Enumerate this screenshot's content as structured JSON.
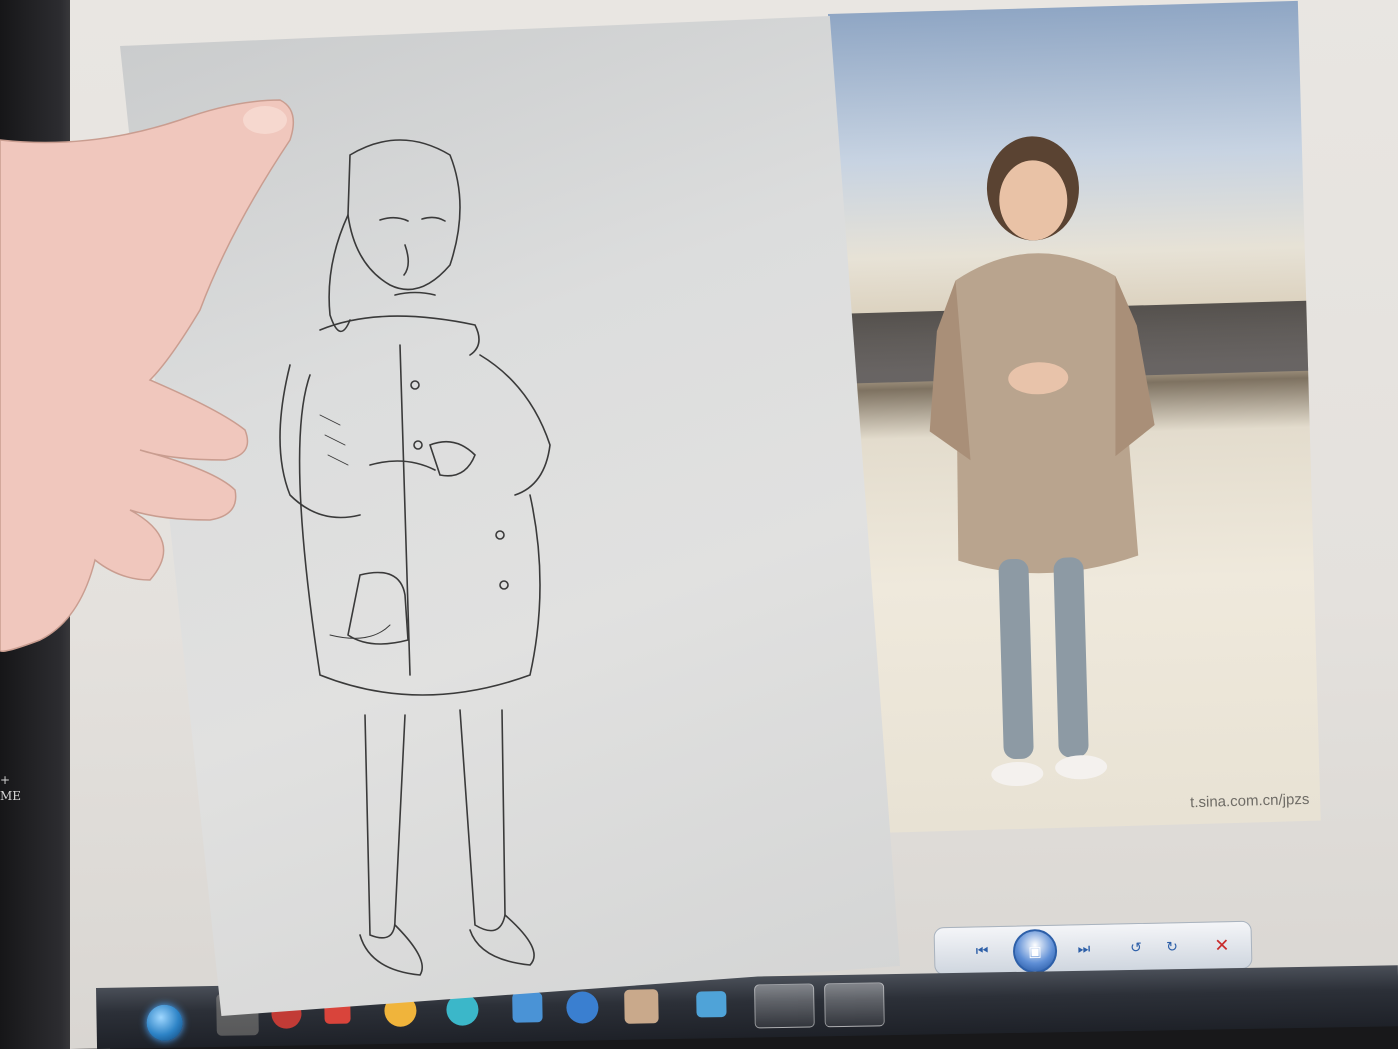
{
  "scene": {
    "watermark": "t.sina.com.cn/jpzs",
    "side_text": [
      "+",
      "ME"
    ],
    "colors": {
      "screen": "#e6e3df",
      "paper": "#dcdddd",
      "coat": "#b9a48e",
      "skin": "#f0c7bd"
    }
  },
  "viewer_toolbar": {
    "buttons": [
      "previous-icon",
      "slideshow-icon",
      "next-icon",
      "rotate-left-icon",
      "rotate-right-icon",
      "delete-icon"
    ]
  },
  "taskbar": {
    "items": [
      "start-orb-icon",
      "app-icon",
      "app-icon",
      "app-icon",
      "app-icon",
      "app-icon",
      "app-icon",
      "app-icon",
      "app-icon",
      "app-icon",
      "app-icon",
      "app-icon"
    ]
  }
}
